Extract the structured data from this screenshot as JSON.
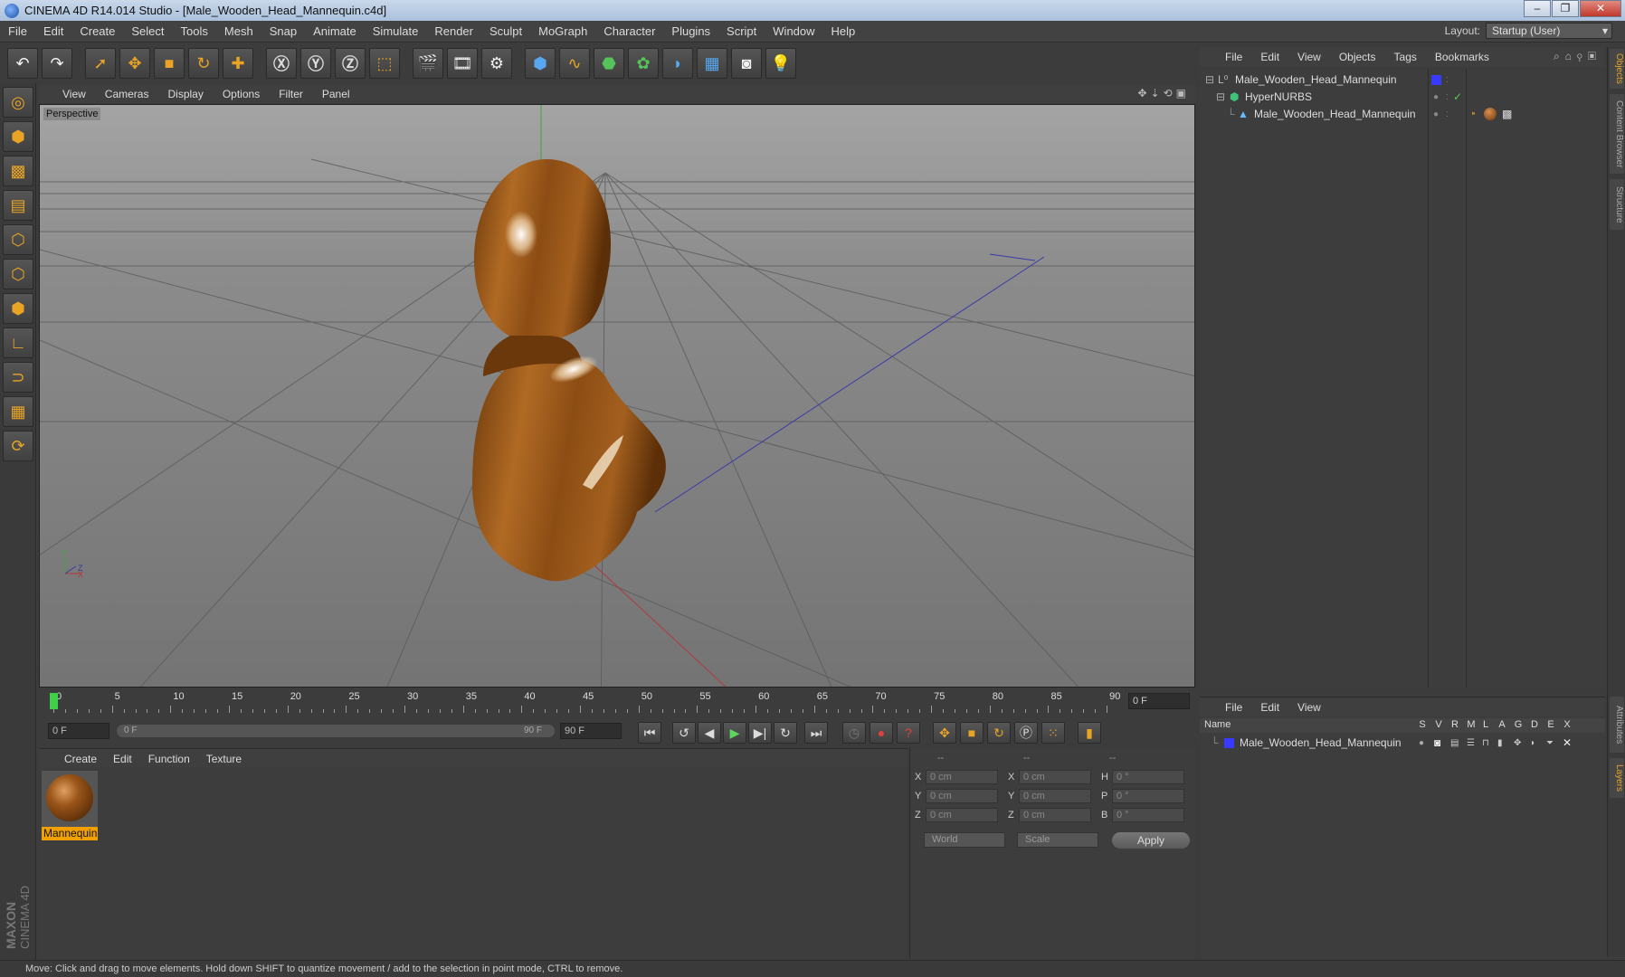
{
  "window": {
    "title": "CINEMA 4D R14.014 Studio - [Male_Wooden_Head_Mannequin.c4d]"
  },
  "menubar": [
    "File",
    "Edit",
    "Create",
    "Select",
    "Tools",
    "Mesh",
    "Snap",
    "Animate",
    "Simulate",
    "Render",
    "Sculpt",
    "MoGraph",
    "Character",
    "Plugins",
    "Script",
    "Window",
    "Help"
  ],
  "layout": {
    "label": "Layout:",
    "value": "Startup (User)"
  },
  "viewport": {
    "menu": [
      "View",
      "Cameras",
      "Display",
      "Options",
      "Filter",
      "Panel"
    ],
    "camera_label": "Perspective",
    "axis_x": "X",
    "axis_y": "Y",
    "axis_z": "Z"
  },
  "timeline": {
    "ticks": [
      "0",
      "5",
      "10",
      "15",
      "20",
      "25",
      "30",
      "35",
      "40",
      "45",
      "50",
      "55",
      "60",
      "65",
      "70",
      "75",
      "80",
      "85",
      "90"
    ],
    "current_frame": "0 F",
    "start_frame": "0 F",
    "range_start": "0 F",
    "range_end": "90 F",
    "end_frame": "90 F"
  },
  "material_manager": {
    "menu": [
      "Create",
      "Edit",
      "Function",
      "Texture"
    ],
    "material_name": "Mannequin"
  },
  "coordinates": {
    "headers": [
      "--",
      "--",
      "--"
    ],
    "rows": [
      {
        "a": "X",
        "av": "0 cm",
        "b": "X",
        "bv": "0 cm",
        "c": "H",
        "cv": "0 °"
      },
      {
        "a": "Y",
        "av": "0 cm",
        "b": "Y",
        "bv": "0 cm",
        "c": "P",
        "cv": "0 °"
      },
      {
        "a": "Z",
        "av": "0 cm",
        "b": "Z",
        "bv": "0 cm",
        "c": "B",
        "cv": "0 °"
      }
    ],
    "mode": "World",
    "transform": "Scale",
    "apply": "Apply"
  },
  "object_manager": {
    "menu": [
      "File",
      "Edit",
      "View",
      "Objects",
      "Tags",
      "Bookmarks"
    ],
    "objects": [
      "Male_Wooden_Head_Mannequin",
      "HyperNURBS",
      "Male_Wooden_Head_Mannequin"
    ]
  },
  "layer_manager": {
    "menu": [
      "File",
      "Edit",
      "View"
    ],
    "columns": [
      "S",
      "V",
      "R",
      "M",
      "L",
      "A",
      "G",
      "D",
      "E",
      "X"
    ],
    "name_header": "Name",
    "layers": [
      "Male_Wooden_Head_Mannequin"
    ]
  },
  "side_tabs": [
    "Objects",
    "Content Browser",
    "Structure",
    "Attributes",
    "Layers"
  ],
  "branding": {
    "maxon": "MAXON",
    "product": "CINEMA 4D"
  },
  "status": "Move: Click and drag to move elements. Hold down SHIFT to quantize movement / add to the selection in point mode, CTRL to remove.",
  "colors": {
    "accent": "#f0a000",
    "layer_color": "#3a3aff",
    "wood": "#9a5519"
  }
}
